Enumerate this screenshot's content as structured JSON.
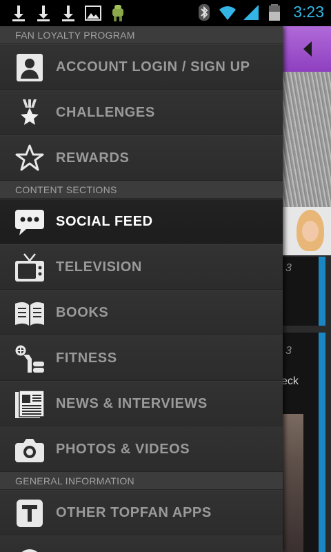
{
  "status_bar": {
    "time": "3:23",
    "icons": [
      "download-icon",
      "download-icon",
      "download-icon",
      "image-icon",
      "android-icon",
      "bluetooth-icon",
      "wifi-icon",
      "signal-icon",
      "battery-icon"
    ]
  },
  "drawer": {
    "sections": [
      {
        "header": "FAN LOYALTY PROGRAM",
        "items": [
          {
            "label": "ACCOUNT LOGIN / SIGN UP",
            "icon": "account-icon"
          },
          {
            "label": "CHALLENGES",
            "icon": "challenges-icon"
          },
          {
            "label": "REWARDS",
            "icon": "star-icon"
          }
        ]
      },
      {
        "header": "CONTENT SECTIONS",
        "items": [
          {
            "label": "SOCIAL FEED",
            "icon": "speech-bubble-icon",
            "active": true
          },
          {
            "label": "TELEVISION",
            "icon": "tv-icon"
          },
          {
            "label": "BOOKS",
            "icon": "book-icon"
          },
          {
            "label": "FITNESS",
            "icon": "fitness-icon"
          },
          {
            "label": "NEWS & INTERVIEWS",
            "icon": "newspaper-icon"
          },
          {
            "label": "PHOTOS & VIDEOS",
            "icon": "camera-icon"
          }
        ]
      },
      {
        "header": "GENERAL INFORMATION",
        "items": [
          {
            "label": "OTHER TOPFAN APPS",
            "icon": "topfan-t-icon"
          }
        ]
      }
    ]
  },
  "background_app": {
    "accent_color": "#9b4fcf",
    "stripe_color": "#1b86c4",
    "card1_number": "3",
    "card2_number": "3",
    "card2_text": "eck"
  }
}
